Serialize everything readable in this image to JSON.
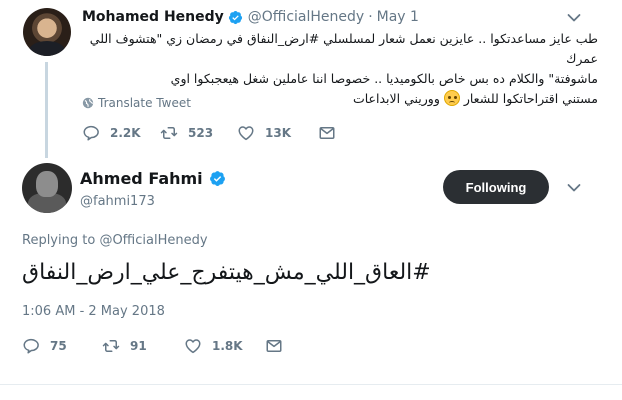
{
  "parent_tweet": {
    "display_name": "Mohamed Henedy",
    "handle": "@OfficialHenedy",
    "separator": "·",
    "date": "May 1",
    "text_lines": [
      "طب عايز مساعدتكوا .. عايزين نعمل شعار لمسلسلي #ارض_النفاق في رمضان زي \"هتشوف اللي عمرك",
      "ماشوفتة\" والكلام ده بس خاص بالكوميديا .. خصوصا اننا عاملين شغل هيعجبكوا اوي",
      "مستني اقتراحاتكوا للشعار",
      "ووريني الابداعات"
    ],
    "translate_label": "Translate Tweet",
    "replies": "2.2K",
    "retweets": "523",
    "likes": "13K"
  },
  "main_tweet": {
    "display_name": "Ahmed Fahmi",
    "handle": "@fahmi173",
    "follow_label": "Following",
    "replying_prefix": "Replying to",
    "replying_to": "@OfficialHenedy",
    "text": "#العاق_اللي_مش_هيتفرج_علي_ارض_النفاق",
    "timestamp": "1:06 AM - 2 May 2018",
    "replies": "75",
    "retweets": "91",
    "likes": "1.8K"
  },
  "icons": {
    "verified": "verified-badge-icon",
    "chevron": "chevron-down-icon",
    "globe": "globe-icon",
    "reply": "reply-icon",
    "retweet": "retweet-icon",
    "like": "heart-icon",
    "message": "direct-message-icon",
    "emoji": "worried-face-emoji"
  },
  "colors": {
    "accent_blue": "#1da1f2",
    "muted_text": "#657786",
    "following_button_bg": "#2b2f33",
    "thread_line": "#c8d6e0"
  }
}
